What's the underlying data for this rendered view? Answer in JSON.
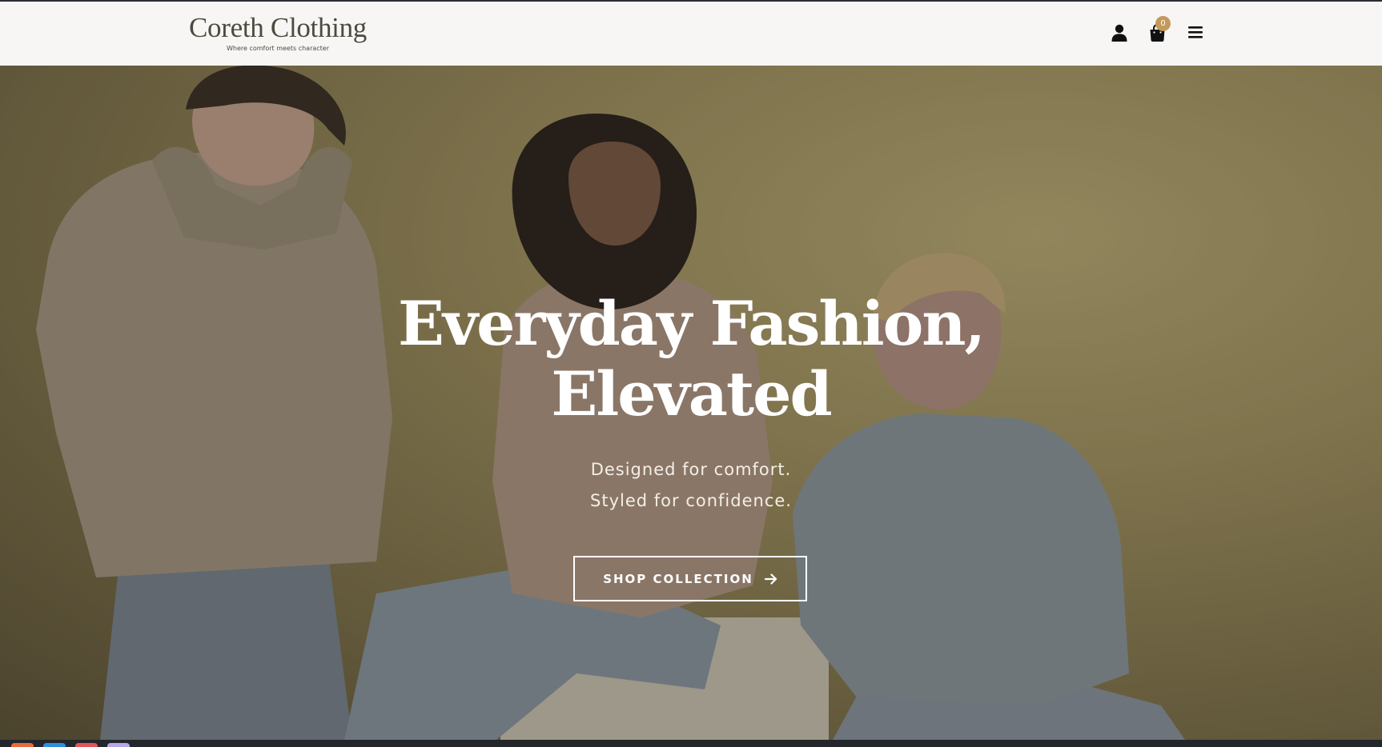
{
  "header": {
    "brand_name": "Coreth Clothing",
    "tagline": "Where comfort meets character",
    "cart_count": "0",
    "icons": [
      "user-icon",
      "shopping-bag-icon",
      "hamburger-menu-icon"
    ]
  },
  "hero": {
    "title_line1": "Everyday Fashion,",
    "title_line2": "Elevated",
    "subtitle_line1": "Designed for comfort.",
    "subtitle_line2": "Styled for confidence.",
    "cta_label": "SHOP COLLECTION",
    "cta_icon": "arrow-right-icon"
  },
  "taskbar": {
    "apps": [
      {
        "icon": "taskbar-app-icon",
        "color": "#e96a3a"
      },
      {
        "icon": "taskbar-app-icon",
        "color": "#2e8fe0"
      },
      {
        "icon": "taskbar-app-icon",
        "color": "#e0565b"
      },
      {
        "icon": "taskbar-app-icon",
        "color": "#b5a8e8"
      }
    ]
  },
  "colors": {
    "header_bg": "#f7f6f4",
    "brand_text": "#4d4a3f",
    "badge": "#c49a5a",
    "icon": "#111111",
    "hero_text": "#ffffff"
  }
}
